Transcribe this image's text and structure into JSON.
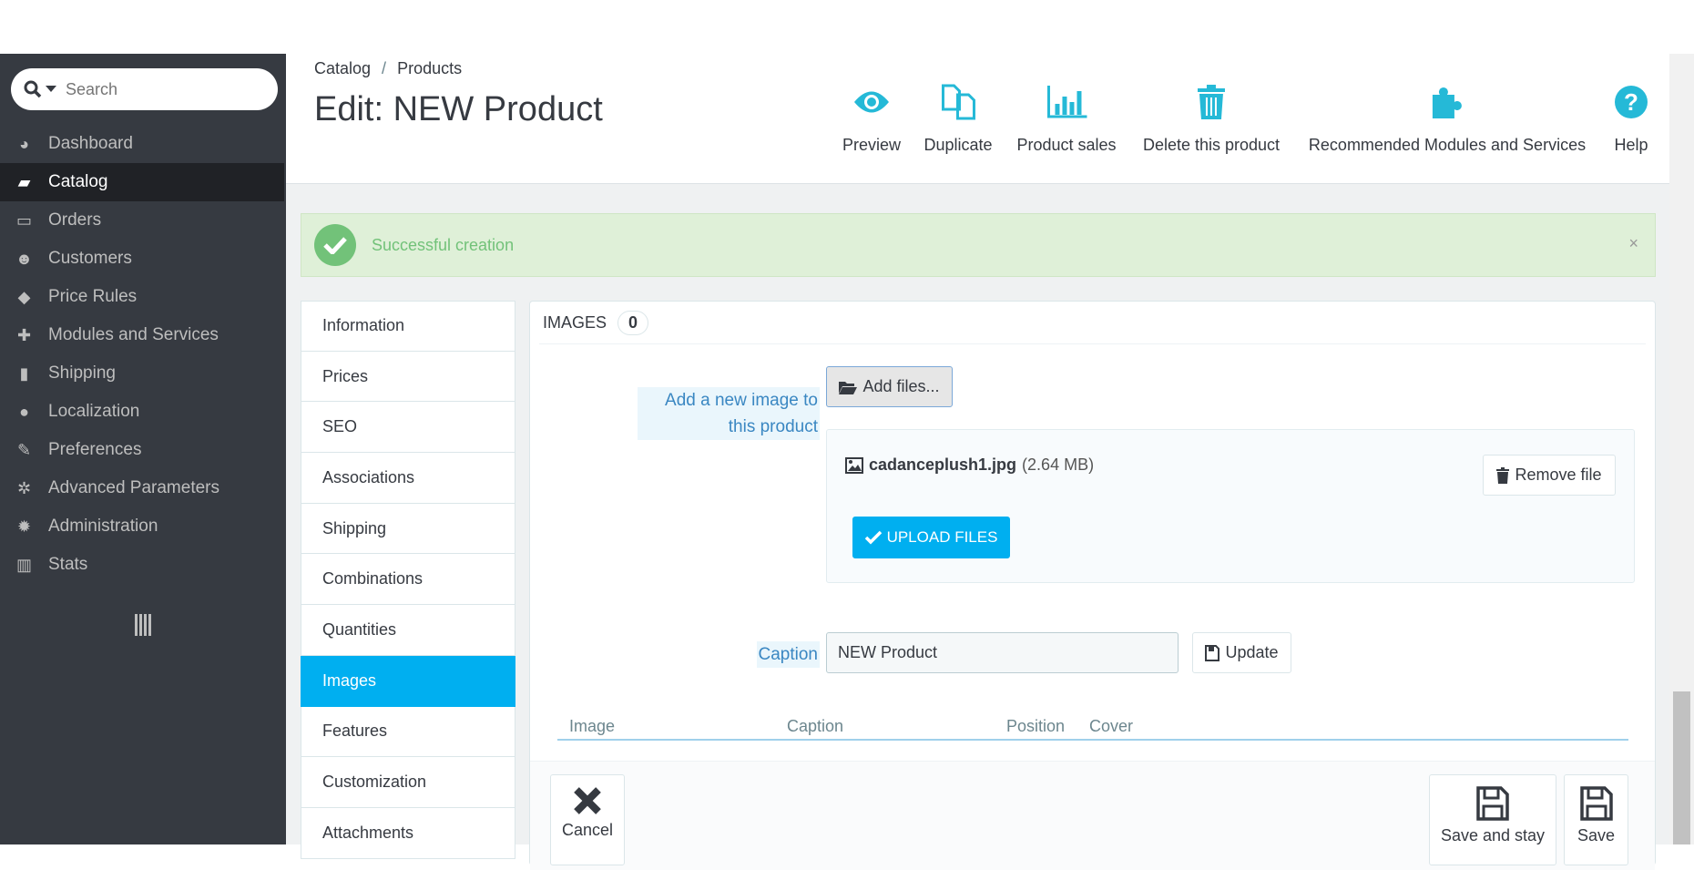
{
  "search": {
    "placeholder": "Search"
  },
  "sidebar": {
    "items": [
      {
        "label": "Dashboard",
        "icon": "dashboard-icon"
      },
      {
        "label": "Catalog",
        "icon": "book-icon",
        "active": true
      },
      {
        "label": "Orders",
        "icon": "credit-card-icon"
      },
      {
        "label": "Customers",
        "icon": "users-icon"
      },
      {
        "label": "Price Rules",
        "icon": "tags-icon"
      },
      {
        "label": "Modules and Services",
        "icon": "puzzle-icon"
      },
      {
        "label": "Shipping",
        "icon": "truck-icon"
      },
      {
        "label": "Localization",
        "icon": "globe-icon"
      },
      {
        "label": "Preferences",
        "icon": "wrench-icon"
      },
      {
        "label": "Advanced Parameters",
        "icon": "cogs-icon"
      },
      {
        "label": "Administration",
        "icon": "cog-icon"
      },
      {
        "label": "Stats",
        "icon": "bar-chart-icon"
      }
    ]
  },
  "header": {
    "breadcrumb": [
      "Catalog",
      "Products"
    ],
    "title": "Edit: NEW Product",
    "toolbar": [
      {
        "label": "Preview",
        "icon": "eye-icon"
      },
      {
        "label": "Duplicate",
        "icon": "copy-icon"
      },
      {
        "label": "Product sales",
        "icon": "bar-chart-icon"
      },
      {
        "label": "Delete this product",
        "icon": "trash-icon"
      },
      {
        "label": "Recommended Modules and Services",
        "icon": "puzzle-icon"
      },
      {
        "label": "Help",
        "icon": "question-icon"
      }
    ]
  },
  "alert": {
    "message": "Successful creation",
    "close": "×"
  },
  "tabs": [
    "Information",
    "Prices",
    "SEO",
    "Associations",
    "Shipping",
    "Combinations",
    "Quantities",
    "Images",
    "Features",
    "Customization",
    "Attachments"
  ],
  "active_tab": "Images",
  "panel": {
    "title": "IMAGES",
    "count": "0",
    "add_label": "Add a new image to this product",
    "add_button": "Add files...",
    "file": {
      "name": "cadanceplush1.jpg",
      "size": "(2.64 MB)"
    },
    "remove_button": "Remove file",
    "upload_button": "UPLOAD FILES",
    "caption_label": "Caption",
    "caption_value": "NEW Product",
    "update_button": "Update",
    "columns": [
      "Image",
      "Caption",
      "Position",
      "Cover"
    ]
  },
  "footer": {
    "cancel": "Cancel",
    "save_stay": "Save and stay",
    "save": "Save"
  },
  "colors": {
    "accent": "#25b9d7",
    "active_tab": "#00aff0",
    "success": "#72c279",
    "sidebar": "#363a41"
  }
}
